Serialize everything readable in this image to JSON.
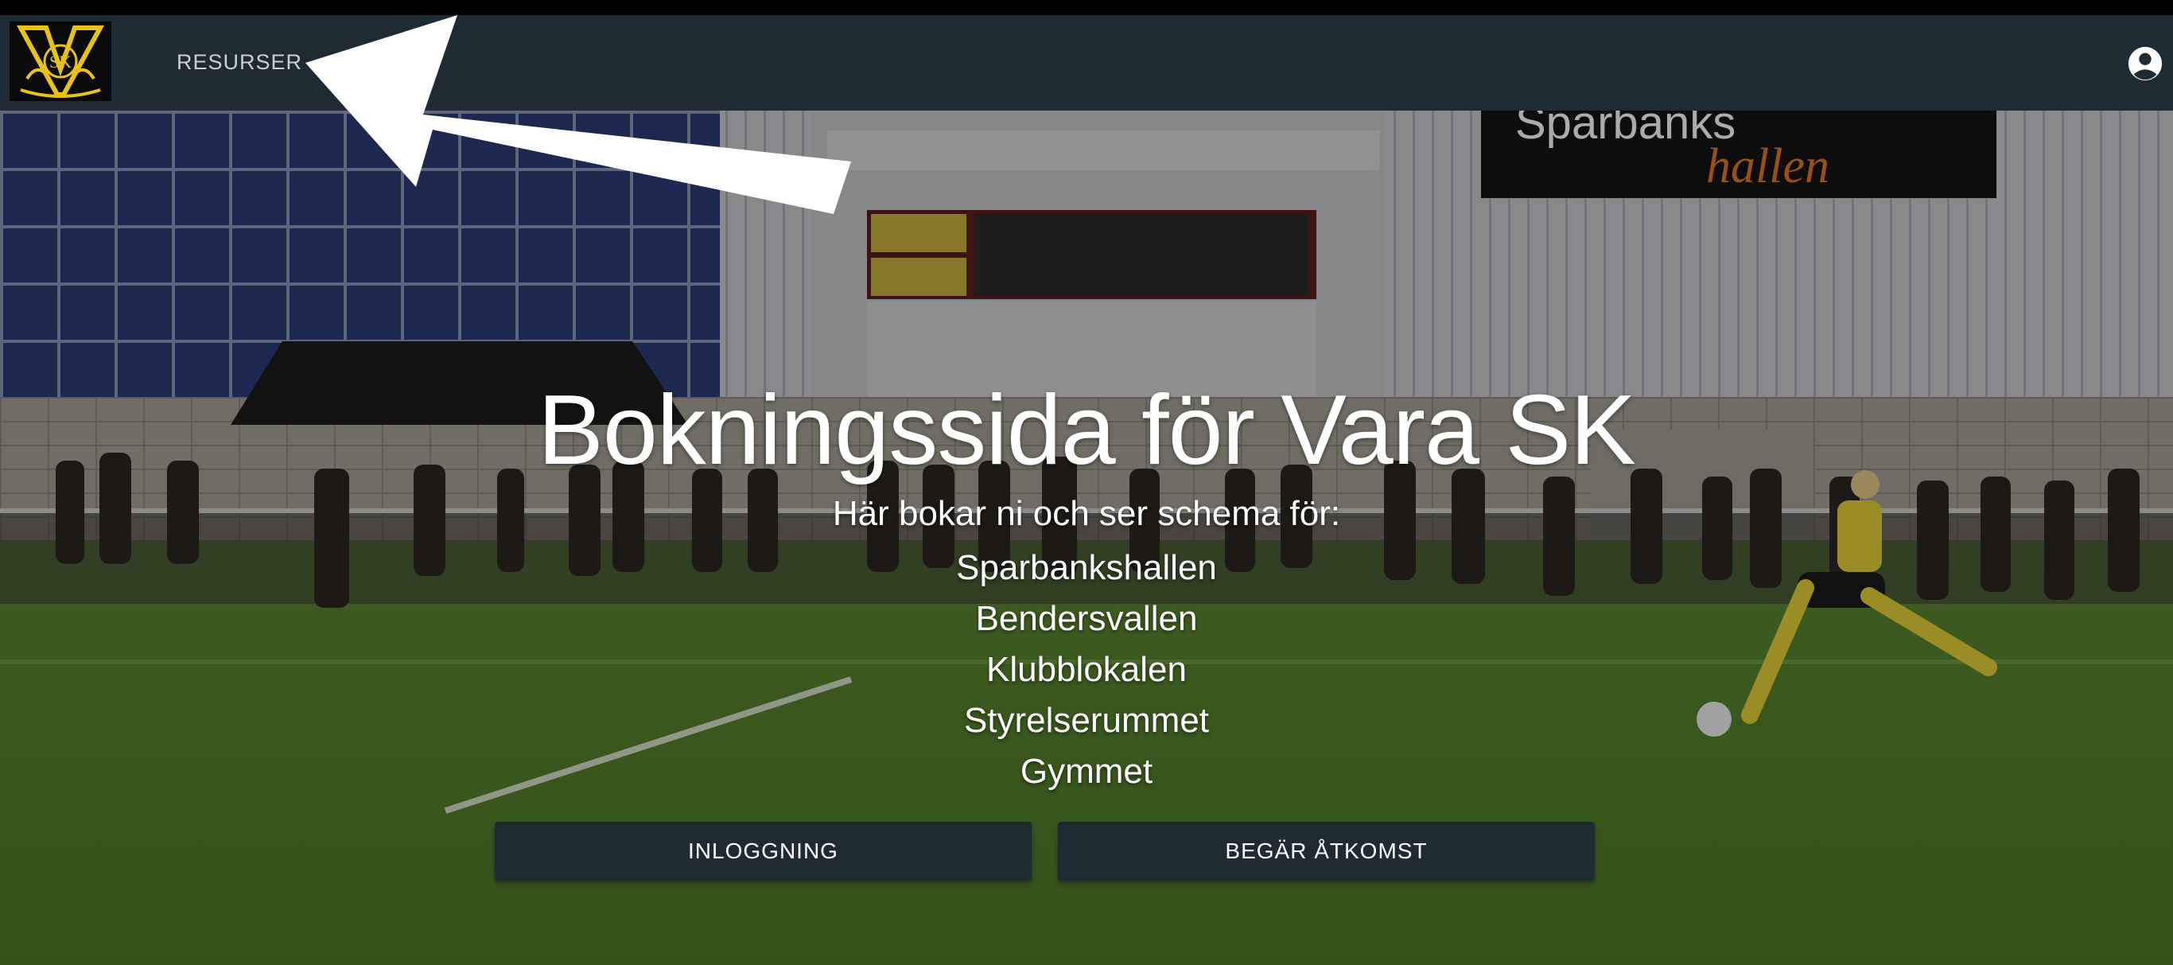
{
  "navbar": {
    "logo_alt": "Vara SK",
    "logo_text": "SK",
    "nav_link": "RESURSER",
    "account_icon": "account-circle-icon"
  },
  "hero": {
    "title": "Bokningssida för Vara SK",
    "subtitle": "Här bokar ni och ser schema för:",
    "venues": [
      "Sparbankshallen",
      "Bendersvallen",
      "Klubblokalen",
      "Styrelserummet",
      "Gymmet"
    ],
    "sign_text_1": "Sparbanks",
    "sign_text_2": "hallen"
  },
  "buttons": {
    "login": "INLOGGNING",
    "request_access": "BEGÄR ÅTKOMST"
  },
  "colors": {
    "navbar": "#1f2b33",
    "button": "#1f2b33",
    "logo_gold": "#e8c21a",
    "text": "#ffffff"
  }
}
